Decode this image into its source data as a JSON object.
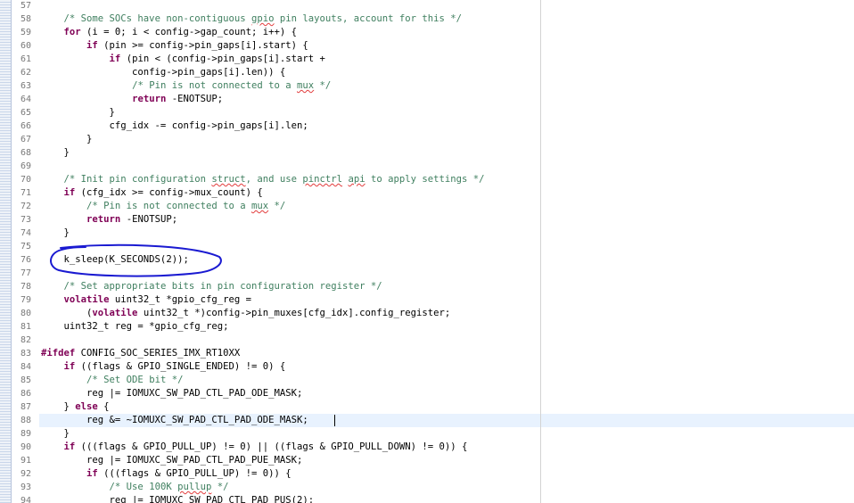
{
  "editor": {
    "annotation_color": "#1a1ad1",
    "keyword_color": "#7f0055",
    "comment_color": "#3f7f5f",
    "lines": [
      {
        "num": "57",
        "segments": []
      },
      {
        "num": "58",
        "segments": [
          {
            "t": "    "
          },
          {
            "t": "/* Some SOCs have non-contiguous ",
            "c": "cm"
          },
          {
            "t": "gpio",
            "c": "cm sp"
          },
          {
            "t": " pin layouts, account for this */",
            "c": "cm"
          }
        ]
      },
      {
        "num": "59",
        "segments": [
          {
            "t": "    "
          },
          {
            "t": "for",
            "c": "kw"
          },
          {
            "t": " (i = 0; i < config->gap_count; i++) {"
          }
        ]
      },
      {
        "num": "60",
        "segments": [
          {
            "t": "        "
          },
          {
            "t": "if",
            "c": "kw"
          },
          {
            "t": " (pin >= config->pin_gaps[i].start) {"
          }
        ]
      },
      {
        "num": "61",
        "segments": [
          {
            "t": "            "
          },
          {
            "t": "if",
            "c": "kw"
          },
          {
            "t": " (pin < (config->pin_gaps[i].start +"
          }
        ]
      },
      {
        "num": "62",
        "segments": [
          {
            "t": "                config->pin_gaps[i].len)) {"
          }
        ]
      },
      {
        "num": "63",
        "segments": [
          {
            "t": "                "
          },
          {
            "t": "/* Pin is not connected to a ",
            "c": "cm"
          },
          {
            "t": "mux",
            "c": "cm sp"
          },
          {
            "t": " */",
            "c": "cm"
          }
        ]
      },
      {
        "num": "64",
        "segments": [
          {
            "t": "                "
          },
          {
            "t": "return",
            "c": "kw"
          },
          {
            "t": " -ENOTSUP;"
          }
        ]
      },
      {
        "num": "65",
        "segments": [
          {
            "t": "            }"
          }
        ]
      },
      {
        "num": "66",
        "segments": [
          {
            "t": "            cfg_idx -= config->pin_gaps[i].len;"
          }
        ]
      },
      {
        "num": "67",
        "segments": [
          {
            "t": "        }"
          }
        ]
      },
      {
        "num": "68",
        "segments": [
          {
            "t": "    }"
          }
        ]
      },
      {
        "num": "69",
        "segments": []
      },
      {
        "num": "70",
        "segments": [
          {
            "t": "    "
          },
          {
            "t": "/* Init pin configuration ",
            "c": "cm"
          },
          {
            "t": "struct",
            "c": "cm sp"
          },
          {
            "t": ", and use ",
            "c": "cm"
          },
          {
            "t": "pinctrl",
            "c": "cm sp"
          },
          {
            "t": " ",
            "c": "cm"
          },
          {
            "t": "api",
            "c": "cm sp"
          },
          {
            "t": " to apply settings */",
            "c": "cm"
          }
        ]
      },
      {
        "num": "71",
        "segments": [
          {
            "t": "    "
          },
          {
            "t": "if",
            "c": "kw"
          },
          {
            "t": " (cfg_idx >= config->mux_count) {"
          }
        ]
      },
      {
        "num": "72",
        "segments": [
          {
            "t": "        "
          },
          {
            "t": "/* Pin is not connected to a ",
            "c": "cm"
          },
          {
            "t": "mux",
            "c": "cm sp"
          },
          {
            "t": " */",
            "c": "cm"
          }
        ]
      },
      {
        "num": "73",
        "segments": [
          {
            "t": "        "
          },
          {
            "t": "return",
            "c": "kw"
          },
          {
            "t": " -ENOTSUP;"
          }
        ]
      },
      {
        "num": "74",
        "segments": [
          {
            "t": "    }"
          }
        ]
      },
      {
        "num": "75",
        "segments": []
      },
      {
        "num": "76",
        "segments": [
          {
            "t": "    k_sleep(K_SECONDS(2));"
          }
        ]
      },
      {
        "num": "77",
        "segments": []
      },
      {
        "num": "78",
        "segments": [
          {
            "t": "    "
          },
          {
            "t": "/* Set appropriate bits in pin configuration register */",
            "c": "cm"
          }
        ]
      },
      {
        "num": "79",
        "segments": [
          {
            "t": "    "
          },
          {
            "t": "volatile",
            "c": "kw"
          },
          {
            "t": " uint32_t *gpio_cfg_reg ="
          }
        ]
      },
      {
        "num": "80",
        "segments": [
          {
            "t": "        ("
          },
          {
            "t": "volatile",
            "c": "kw"
          },
          {
            "t": " uint32_t *)config->pin_muxes[cfg_idx].config_register;"
          }
        ]
      },
      {
        "num": "81",
        "segments": [
          {
            "t": "    uint32_t reg = *gpio_cfg_reg;"
          }
        ]
      },
      {
        "num": "82",
        "segments": []
      },
      {
        "num": "83",
        "segments": [
          {
            "t": "#ifdef",
            "c": "pp"
          },
          {
            "t": " CONFIG_SOC_SERIES_IMX_RT10XX"
          }
        ]
      },
      {
        "num": "84",
        "segments": [
          {
            "t": "    "
          },
          {
            "t": "if",
            "c": "kw"
          },
          {
            "t": " ((flags & GPIO_SINGLE_ENDED) != 0) {"
          }
        ]
      },
      {
        "num": "85",
        "segments": [
          {
            "t": "        "
          },
          {
            "t": "/* Set ODE bit */",
            "c": "cm"
          }
        ]
      },
      {
        "num": "86",
        "segments": [
          {
            "t": "        reg |= IOMUXC_SW_PAD_CTL_PAD_ODE_MASK;"
          }
        ]
      },
      {
        "num": "87",
        "segments": [
          {
            "t": "    } "
          },
          {
            "t": "else",
            "c": "kw"
          },
          {
            "t": " {"
          }
        ]
      },
      {
        "num": "88",
        "segments": [
          {
            "t": "        reg &= ~IOMUXC_SW_PAD_CTL_PAD_ODE_MASK;"
          }
        ]
      },
      {
        "num": "89",
        "segments": [
          {
            "t": "    }"
          }
        ]
      },
      {
        "num": "90",
        "segments": [
          {
            "t": "    "
          },
          {
            "t": "if",
            "c": "kw"
          },
          {
            "t": " (((flags & GPIO_PULL_UP) != 0) || ((flags & GPIO_PULL_DOWN) != 0)) {"
          }
        ]
      },
      {
        "num": "91",
        "segments": [
          {
            "t": "        reg |= IOMUXC_SW_PAD_CTL_PAD_PUE_MASK;"
          }
        ]
      },
      {
        "num": "92",
        "segments": [
          {
            "t": "        "
          },
          {
            "t": "if",
            "c": "kw"
          },
          {
            "t": " (((flags & GPIO_PULL_UP) != 0)) {"
          }
        ]
      },
      {
        "num": "93",
        "segments": [
          {
            "t": "            "
          },
          {
            "t": "/* Use 100K ",
            "c": "cm"
          },
          {
            "t": "pullup",
            "c": "cm sp"
          },
          {
            "t": " */",
            "c": "cm"
          }
        ]
      },
      {
        "num": "94",
        "segments": [
          {
            "t": "            reg |= IOMUXC_SW_PAD_CTL_PAD_PUS(2);"
          }
        ]
      }
    ]
  }
}
